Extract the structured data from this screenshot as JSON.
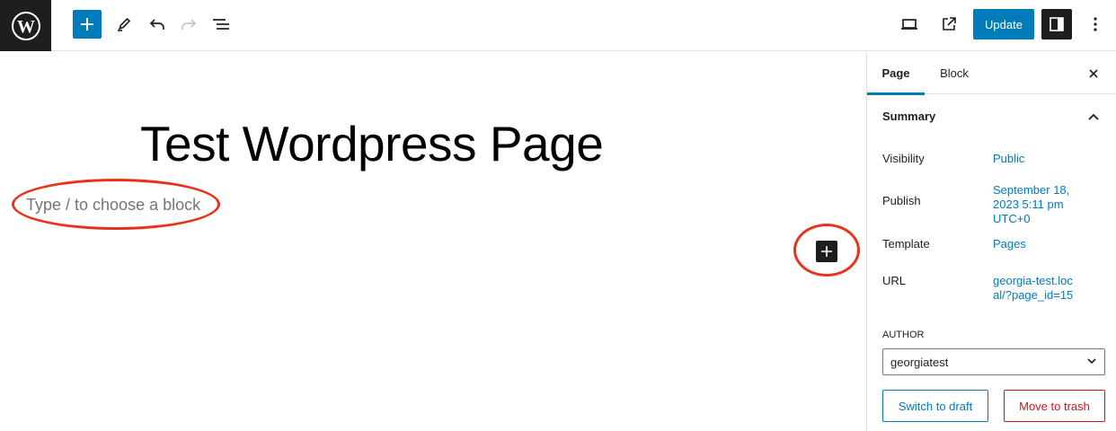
{
  "toolbar": {
    "update_label": "Update"
  },
  "editor": {
    "title": "Test Wordpress Page",
    "placeholder": "Type / to choose a block"
  },
  "sidebar": {
    "tabs": [
      {
        "label": "Page",
        "active": true
      },
      {
        "label": "Block",
        "active": false
      }
    ],
    "summary_title": "Summary",
    "rows": [
      {
        "label": "Visibility",
        "value": "Public"
      },
      {
        "label": "Publish",
        "value": "September 18, 2023 5:11 pm UTC+0"
      },
      {
        "label": "Template",
        "value": "Pages"
      },
      {
        "label": "URL",
        "value": "georgia-test.local/?page_id=15"
      }
    ],
    "author_label": "AUTHOR",
    "author_value": "georgiatest",
    "switch_draft_label": "Switch to draft",
    "move_trash_label": "Move to trash"
  },
  "icons": {
    "logo": "wordpress-logo-icon",
    "add": "plus-icon",
    "tools": "pencil-icon",
    "undo": "undo-icon",
    "redo": "redo-icon",
    "outline": "list-view-icon",
    "preview": "laptop-icon",
    "view": "external-link-icon",
    "settings": "sidebar-toggle-icon",
    "options": "more-vertical-icon"
  },
  "colors": {
    "accent": "#007cba",
    "annotation": "#e8331c",
    "danger": "#cc1818"
  }
}
